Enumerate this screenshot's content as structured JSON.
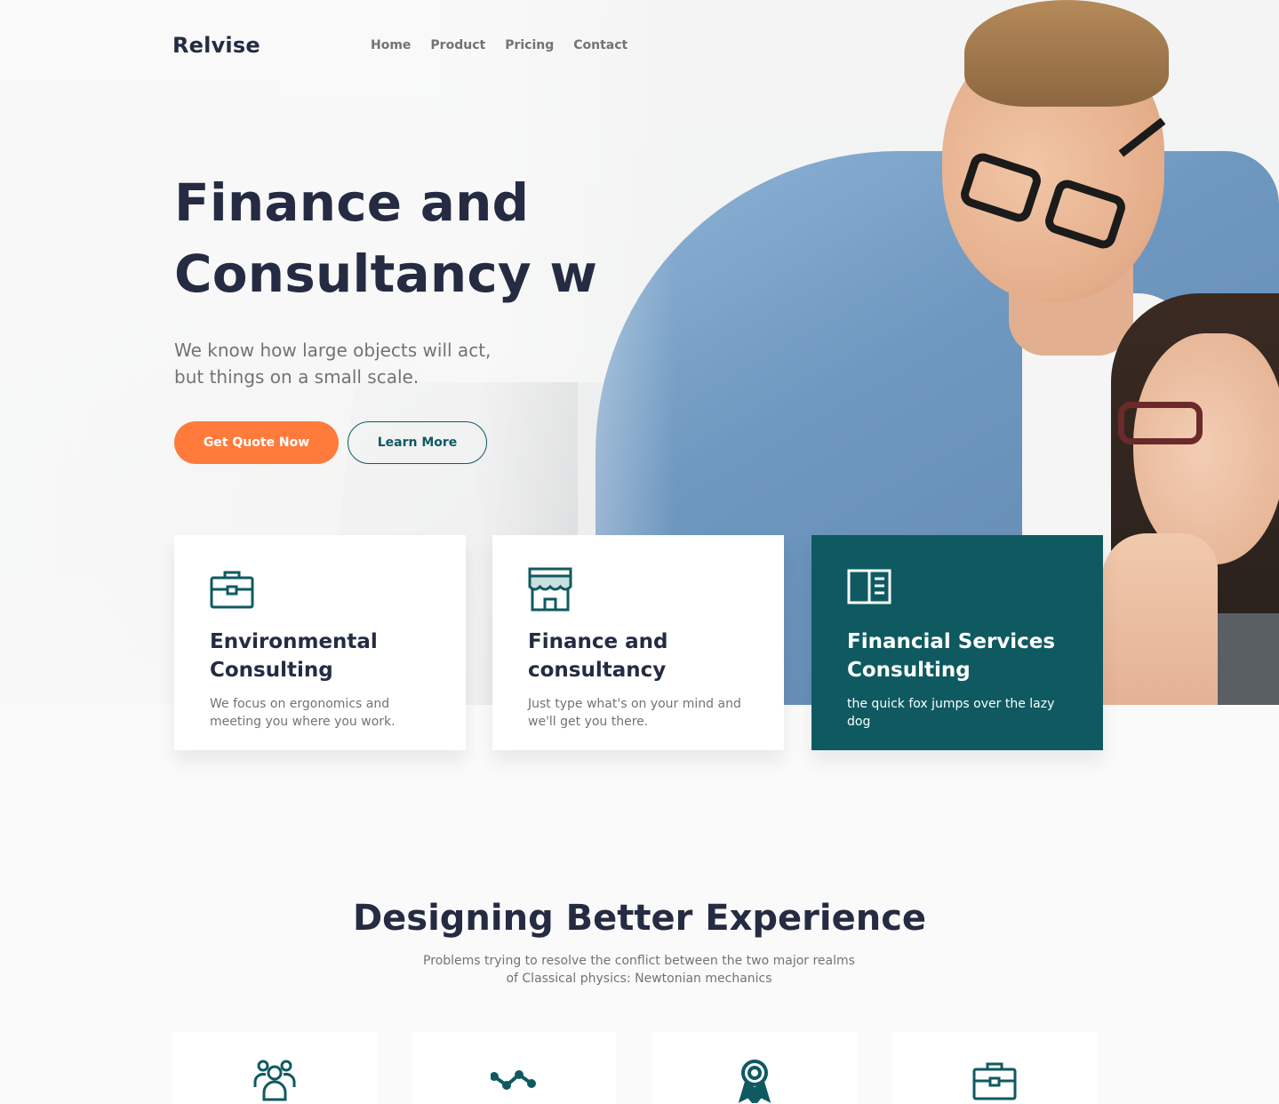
{
  "brand": "Relvise",
  "nav": [
    "Home",
    "Product",
    "Pricing",
    "Contact"
  ],
  "hero": {
    "title_line1": "Finance and",
    "title_line2": "Consultancy w",
    "subtitle_line1": "We know how large objects will act,",
    "subtitle_line2": "but things on a small scale.",
    "primary_button": "Get Quote Now",
    "secondary_button": "Learn More"
  },
  "cards": [
    {
      "icon": "briefcase-icon",
      "title_line1": "Environmental",
      "title_line2": "Consulting",
      "text": "We focus on ergonomics and meeting you where you work."
    },
    {
      "icon": "storefront-icon",
      "title_line1": "Finance and",
      "title_line2": "consultancy",
      "text": "Just type what's on your mind and we'll get you there."
    },
    {
      "icon": "book-icon",
      "title_line1": "Financial Services",
      "title_line2": "Consulting",
      "text": "the quick fox jumps over the lazy dog"
    }
  ],
  "section": {
    "title": "Designing Better Experience",
    "subtitle_line1": "Problems trying to resolve the conflict between the two major realms",
    "subtitle_line2": "of Classical physics: Newtonian mechanics"
  },
  "mini_icons": [
    "users-icon",
    "trend-icon",
    "award-icon",
    "briefcase-icon"
  ],
  "colors": {
    "primary": "#ff7b3c",
    "teal": "#0f5a60",
    "heading": "#252b42",
    "muted": "#737373"
  }
}
